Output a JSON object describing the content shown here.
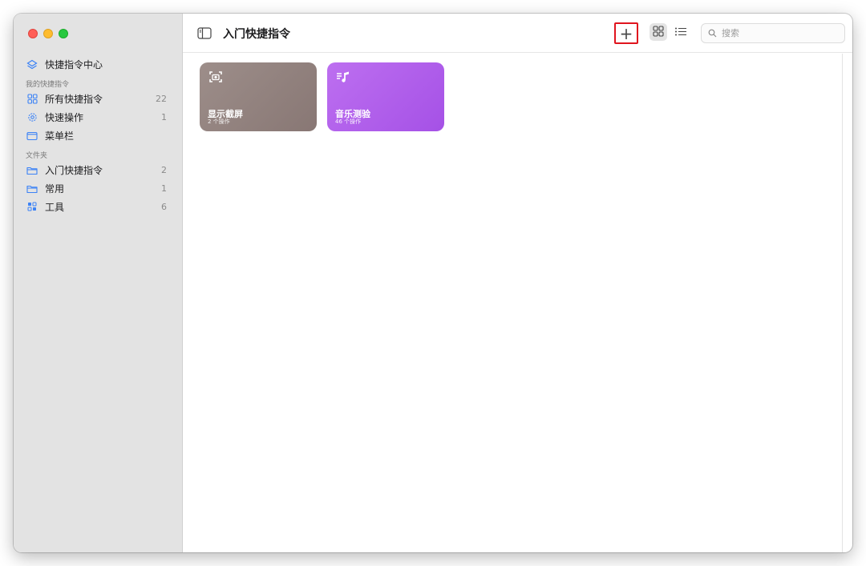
{
  "sidebar": {
    "gallery": {
      "label": "快捷指令中心",
      "icon": "layers-icon"
    },
    "my_section": "我的快捷指令",
    "items": [
      {
        "label": "所有快捷指令",
        "count": "22",
        "icon": "grid-icon"
      },
      {
        "label": "快速操作",
        "count": "1",
        "icon": "gear-icon"
      },
      {
        "label": "菜单栏",
        "count": "",
        "icon": "menubar-icon"
      }
    ],
    "folders_section": "文件夹",
    "folders": [
      {
        "label": "入门快捷指令",
        "count": "2",
        "icon": "folder-icon"
      },
      {
        "label": "常用",
        "count": "1",
        "icon": "folder-icon"
      },
      {
        "label": "工具",
        "count": "6",
        "icon": "apps-icon"
      }
    ]
  },
  "toolbar": {
    "title": "入门快捷指令",
    "add_label": "+",
    "search_placeholder": "搜索"
  },
  "shortcuts": [
    {
      "name": "显示截屏",
      "subtitle": "2 个操作",
      "color": "#8f7f7b",
      "icon": "screenshot-icon"
    },
    {
      "name": "音乐测验",
      "subtitle": "46 个操作",
      "color": "#b05ee9",
      "icon": "music-list-icon"
    }
  ],
  "colors": {
    "accent": "#3b82f6",
    "highlight_box": "#e0141e"
  }
}
